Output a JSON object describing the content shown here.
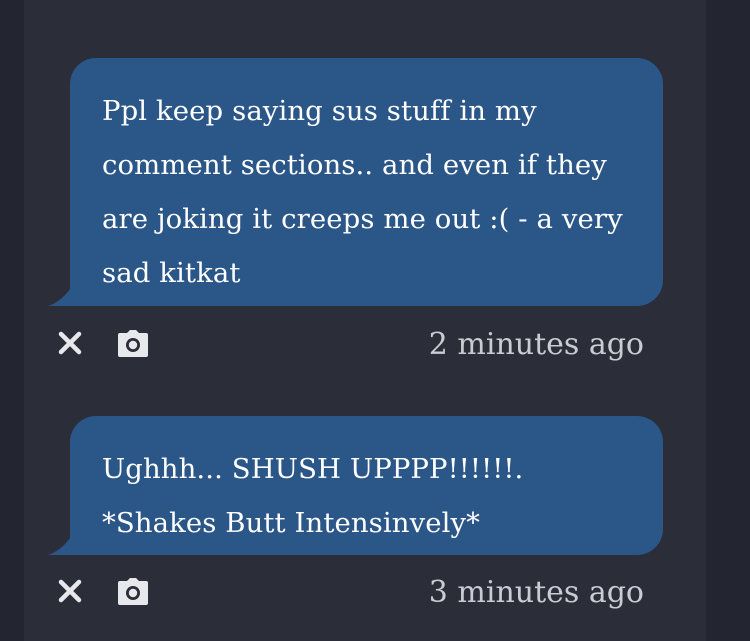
{
  "messages": [
    {
      "text": "Ppl keep saying sus stuff in my comment sections.. and even if they are joking it creeps me out :( - a very sad kitkat",
      "timestamp": "2 minutes ago",
      "actions": {
        "delete_icon": "close-icon",
        "screenshot_icon": "camera-icon"
      }
    },
    {
      "text": "Ughhh... SHUSH UPPPP!!!!!!. *Shakes Butt Intensinvely*",
      "timestamp": "3 minutes ago",
      "actions": {
        "delete_icon": "close-icon",
        "screenshot_icon": "camera-icon"
      }
    }
  ],
  "colors": {
    "background": "#232630",
    "panel": "#2b2e38",
    "bubble": "#2b5688",
    "bubble_text": "#ffffff",
    "meta_text": "#c9ccd3"
  }
}
